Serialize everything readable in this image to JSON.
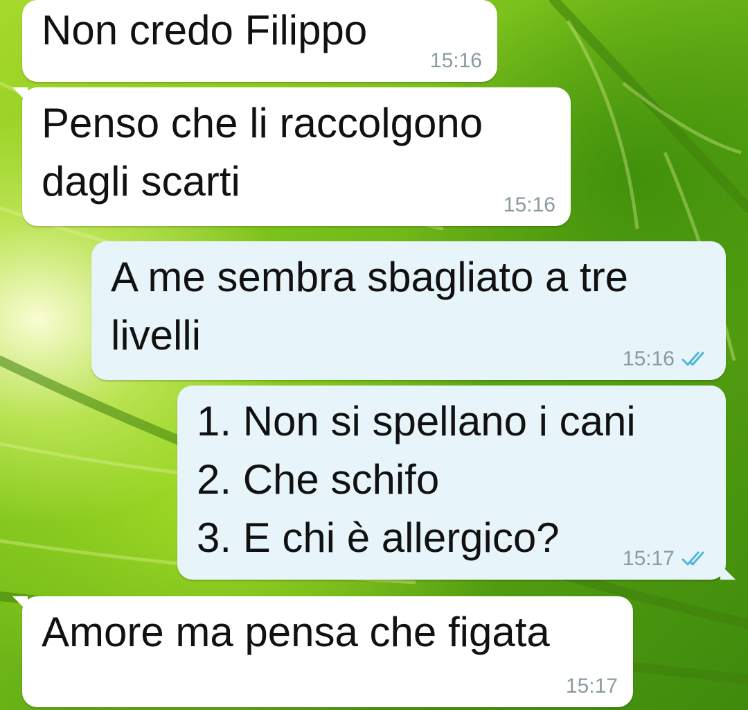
{
  "messages": [
    {
      "direction": "incoming",
      "text": "Non credo Filippo",
      "time": "15:16"
    },
    {
      "direction": "incoming",
      "text": "Penso che li raccolgono\ndagli scarti",
      "time": "15:16"
    },
    {
      "direction": "outgoing",
      "text": "A me sembra sbagliato a tre\nlivelli",
      "time": "15:16",
      "status": "read"
    },
    {
      "direction": "outgoing",
      "text": "1. Non si spellano i cani\n2. Che schifo\n3. E chi è allergico?",
      "time": "15:17",
      "status": "read"
    },
    {
      "direction": "incoming",
      "text": "Amore ma pensa che figata",
      "time": "15:17"
    }
  ],
  "wallpaper": "green-leaf",
  "colors": {
    "incoming_bubble": "#ffffff",
    "outgoing_bubble": "#e7f4f9",
    "read_ticks": "#4fb6d8",
    "timestamp": "#8a9a9f"
  }
}
